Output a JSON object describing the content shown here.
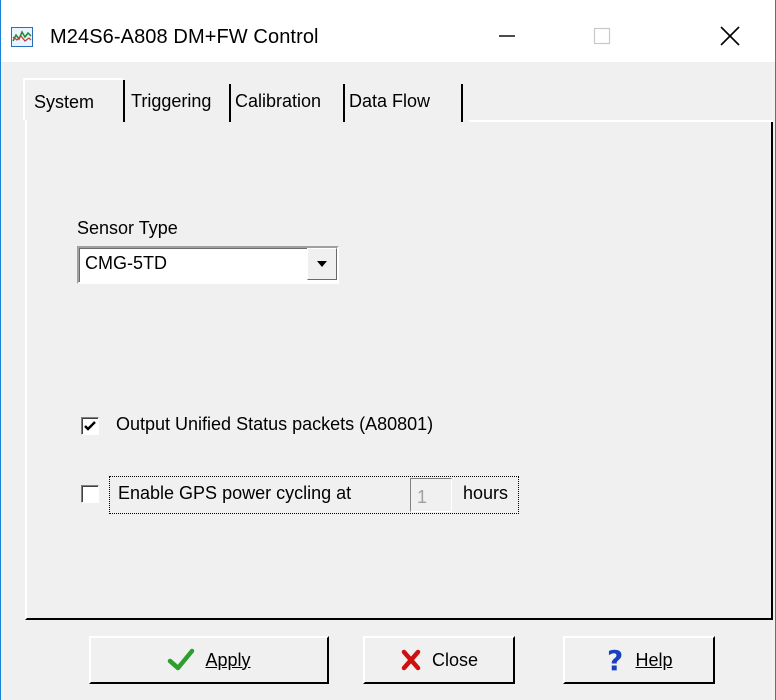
{
  "window": {
    "title": "M24S6-A808 DM+FW Control",
    "icon": "chart-app-icon",
    "controls": {
      "minimize": "minimize-icon",
      "maximize": "maximize-icon",
      "close": "close-icon"
    }
  },
  "tabs": [
    {
      "label": "System",
      "selected": true
    },
    {
      "label": "Triggering",
      "selected": false
    },
    {
      "label": "Calibration",
      "selected": false
    },
    {
      "label": "Data Flow",
      "selected": false
    }
  ],
  "system": {
    "sensor_type_label": "Sensor Type",
    "sensor_type_value": "CMG-5TD",
    "unified_status": {
      "label": "Output Unified Status packets (A80801)",
      "checked": true
    },
    "gps_cycling": {
      "label": "Enable GPS power cycling at",
      "checked": false,
      "hours_value": "1",
      "hours_suffix": "hours"
    }
  },
  "buttons": {
    "apply": {
      "label": "Apply",
      "icon": "checkmark-icon",
      "color": "#2e9e2e"
    },
    "close": {
      "label": "Close",
      "icon": "red-x-icon",
      "color": "#cc1111"
    },
    "help": {
      "label": "Help",
      "icon": "question-mark-icon",
      "color": "#1a3fbf"
    }
  }
}
